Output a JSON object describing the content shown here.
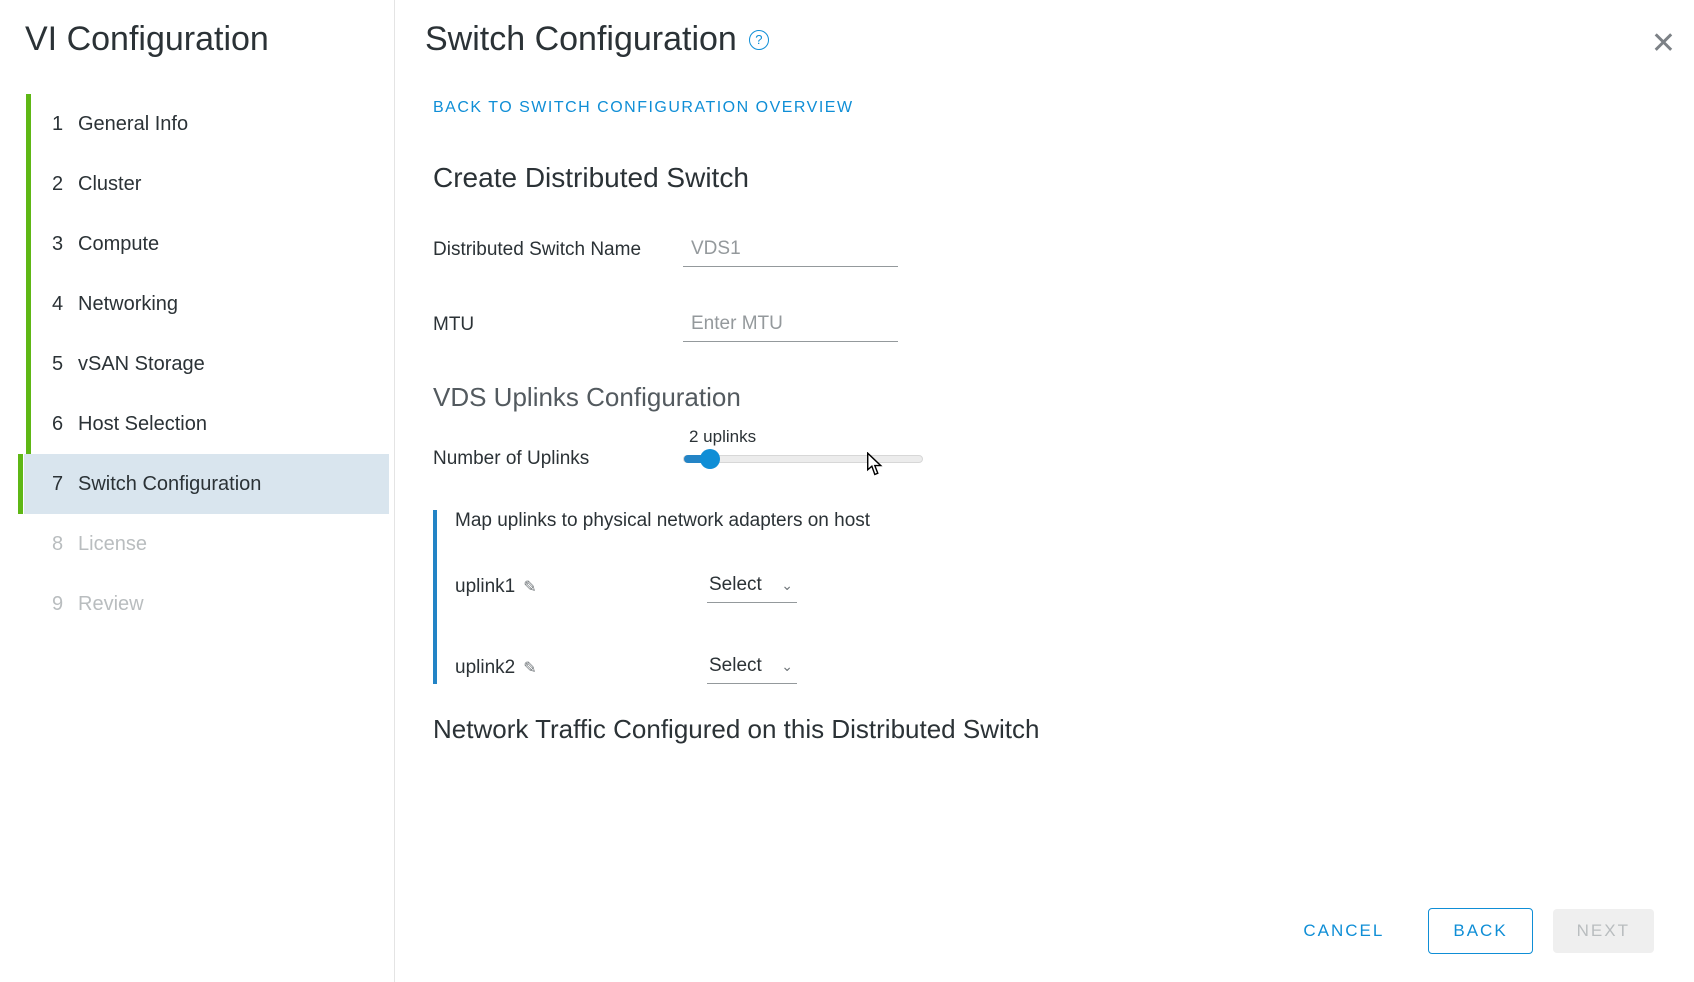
{
  "sidebar": {
    "title": "VI Configuration",
    "steps": [
      {
        "num": "1",
        "label": "General Info",
        "state": "completed"
      },
      {
        "num": "2",
        "label": "Cluster",
        "state": "completed"
      },
      {
        "num": "3",
        "label": "Compute",
        "state": "completed"
      },
      {
        "num": "4",
        "label": "Networking",
        "state": "completed"
      },
      {
        "num": "5",
        "label": "vSAN Storage",
        "state": "completed"
      },
      {
        "num": "6",
        "label": "Host Selection",
        "state": "completed"
      },
      {
        "num": "7",
        "label": "Switch Configuration",
        "state": "active"
      },
      {
        "num": "8",
        "label": "License",
        "state": "disabled"
      },
      {
        "num": "9",
        "label": "Review",
        "state": "disabled"
      }
    ]
  },
  "header": {
    "title": "Switch Configuration",
    "back_link": "BACK TO SWITCH CONFIGURATION OVERVIEW"
  },
  "form": {
    "section1_title": "Create Distributed Switch",
    "ds_name_label": "Distributed Switch Name",
    "ds_name_placeholder": "VDS1",
    "mtu_label": "MTU",
    "mtu_placeholder": "Enter MTU",
    "section2_title": "VDS Uplinks Configuration",
    "uplinks_label": "Number of Uplinks",
    "uplinks_caption": "2 uplinks",
    "map_hint": "Map uplinks to physical network adapters on host",
    "uplink1": "uplink1",
    "uplink2": "uplink2",
    "select_text": "Select",
    "section3_title": "Network Traffic Configured on this Distributed Switch"
  },
  "footer": {
    "cancel": "CANCEL",
    "back": "BACK",
    "next": "NEXT"
  }
}
